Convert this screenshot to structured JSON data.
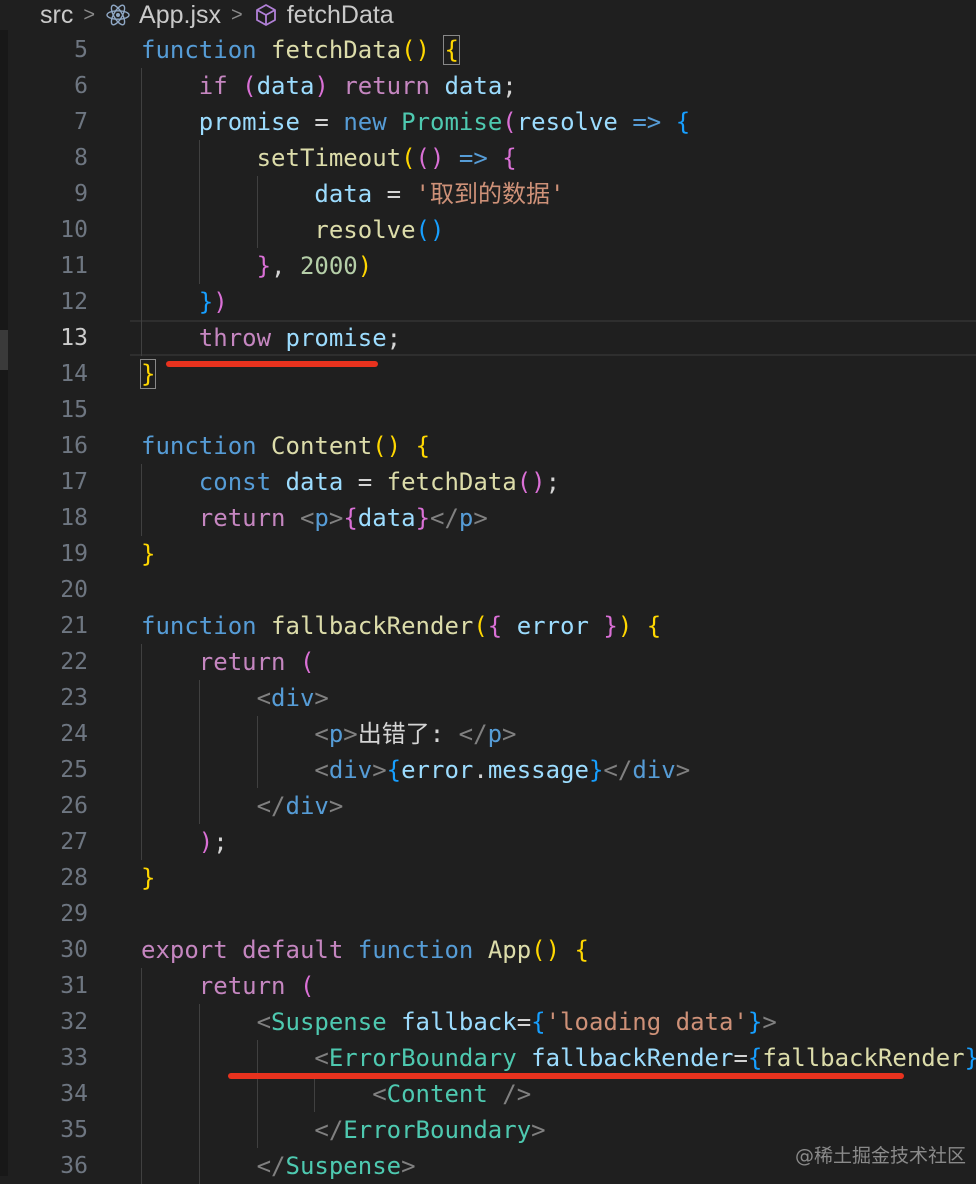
{
  "breadcrumb": {
    "folder": "src",
    "file": "App.jsx",
    "symbol": "fetchData",
    "file_icon": "react-icon",
    "symbol_icon": "cube-method-icon"
  },
  "lines": [
    {
      "n": "5",
      "indent": 0,
      "tokens": [
        [
          "kw-blue",
          "function"
        ],
        [
          "punc",
          " "
        ],
        [
          "fn",
          "fetchData"
        ],
        [
          "b1",
          "()"
        ],
        [
          "punc",
          " "
        ],
        [
          "b1",
          "{"
        ]
      ]
    },
    {
      "n": "6",
      "indent": 1,
      "tokens": [
        [
          "kw-pink",
          "if"
        ],
        [
          "punc",
          " "
        ],
        [
          "b2",
          "("
        ],
        [
          "var",
          "data"
        ],
        [
          "b2",
          ")"
        ],
        [
          "punc",
          " "
        ],
        [
          "kw-pink",
          "return"
        ],
        [
          "punc",
          " "
        ],
        [
          "var",
          "data"
        ],
        [
          "punc",
          ";"
        ]
      ]
    },
    {
      "n": "7",
      "indent": 1,
      "tokens": [
        [
          "var",
          "promise"
        ],
        [
          "punc",
          " = "
        ],
        [
          "kw-blue",
          "new"
        ],
        [
          "punc",
          " "
        ],
        [
          "cls",
          "Promise"
        ],
        [
          "b2",
          "("
        ],
        [
          "var",
          "resolve"
        ],
        [
          "punc",
          " "
        ],
        [
          "kw-blue",
          "=>"
        ],
        [
          "punc",
          " "
        ],
        [
          "b3",
          "{"
        ]
      ]
    },
    {
      "n": "8",
      "indent": 2,
      "tokens": [
        [
          "fn",
          "setTimeout"
        ],
        [
          "b1",
          "("
        ],
        [
          "b2",
          "()"
        ],
        [
          "punc",
          " "
        ],
        [
          "kw-blue",
          "=>"
        ],
        [
          "punc",
          " "
        ],
        [
          "b2",
          "{"
        ]
      ]
    },
    {
      "n": "9",
      "indent": 3,
      "tokens": [
        [
          "var",
          "data"
        ],
        [
          "punc",
          " = "
        ],
        [
          "str",
          "'取到的数据'"
        ]
      ]
    },
    {
      "n": "10",
      "indent": 3,
      "tokens": [
        [
          "fn",
          "resolve"
        ],
        [
          "b3",
          "()"
        ]
      ]
    },
    {
      "n": "11",
      "indent": 2,
      "tokens": [
        [
          "b2",
          "}"
        ],
        [
          "punc",
          ", "
        ],
        [
          "num",
          "2000"
        ],
        [
          "b1",
          ")"
        ]
      ]
    },
    {
      "n": "12",
      "indent": 1,
      "tokens": [
        [
          "b3",
          "}"
        ],
        [
          "b2",
          ")"
        ]
      ]
    },
    {
      "n": "13",
      "indent": 1,
      "current": true,
      "tokens": [
        [
          "kw-pink",
          "throw"
        ],
        [
          "punc",
          " "
        ],
        [
          "var",
          "promise"
        ],
        [
          "punc",
          ";"
        ]
      ]
    },
    {
      "n": "14",
      "indent": 0,
      "tokens": [
        [
          "b1",
          "}"
        ]
      ]
    },
    {
      "n": "15",
      "indent": 0,
      "tokens": []
    },
    {
      "n": "16",
      "indent": 0,
      "tokens": [
        [
          "kw-blue",
          "function"
        ],
        [
          "punc",
          " "
        ],
        [
          "fn",
          "Content"
        ],
        [
          "b1",
          "()"
        ],
        [
          "punc",
          " "
        ],
        [
          "b1",
          "{"
        ]
      ]
    },
    {
      "n": "17",
      "indent": 1,
      "tokens": [
        [
          "kw-blue",
          "const"
        ],
        [
          "punc",
          " "
        ],
        [
          "var",
          "data"
        ],
        [
          "punc",
          " = "
        ],
        [
          "fn",
          "fetchData"
        ],
        [
          "b2",
          "()"
        ],
        [
          "punc",
          ";"
        ]
      ]
    },
    {
      "n": "18",
      "indent": 1,
      "tokens": [
        [
          "kw-pink",
          "return"
        ],
        [
          "punc",
          " "
        ],
        [
          "tag",
          "<"
        ],
        [
          "kw-blue",
          "p"
        ],
        [
          "tag",
          ">"
        ],
        [
          "b2",
          "{"
        ],
        [
          "var",
          "data"
        ],
        [
          "b2",
          "}"
        ],
        [
          "tag",
          "</"
        ],
        [
          "kw-blue",
          "p"
        ],
        [
          "tag",
          ">"
        ]
      ]
    },
    {
      "n": "19",
      "indent": 0,
      "tokens": [
        [
          "b1",
          "}"
        ]
      ]
    },
    {
      "n": "20",
      "indent": 0,
      "tokens": []
    },
    {
      "n": "21",
      "indent": 0,
      "tokens": [
        [
          "kw-blue",
          "function"
        ],
        [
          "punc",
          " "
        ],
        [
          "fn",
          "fallbackRender"
        ],
        [
          "b1",
          "("
        ],
        [
          "b2",
          "{"
        ],
        [
          "punc",
          " "
        ],
        [
          "var",
          "error"
        ],
        [
          "punc",
          " "
        ],
        [
          "b2",
          "}"
        ],
        [
          "b1",
          ")"
        ],
        [
          "punc",
          " "
        ],
        [
          "b1",
          "{"
        ]
      ]
    },
    {
      "n": "22",
      "indent": 1,
      "tokens": [
        [
          "kw-pink",
          "return"
        ],
        [
          "punc",
          " "
        ],
        [
          "b2",
          "("
        ]
      ]
    },
    {
      "n": "23",
      "indent": 2,
      "tokens": [
        [
          "tag",
          "<"
        ],
        [
          "kw-blue",
          "div"
        ],
        [
          "tag",
          ">"
        ]
      ]
    },
    {
      "n": "24",
      "indent": 3,
      "tokens": [
        [
          "tag",
          "<"
        ],
        [
          "kw-blue",
          "p"
        ],
        [
          "tag",
          ">"
        ],
        [
          "punc",
          "出错了: "
        ],
        [
          "tag",
          "</"
        ],
        [
          "kw-blue",
          "p"
        ],
        [
          "tag",
          ">"
        ]
      ]
    },
    {
      "n": "25",
      "indent": 3,
      "tokens": [
        [
          "tag",
          "<"
        ],
        [
          "kw-blue",
          "div"
        ],
        [
          "tag",
          ">"
        ],
        [
          "b3",
          "{"
        ],
        [
          "var",
          "error"
        ],
        [
          "punc",
          "."
        ],
        [
          "var",
          "message"
        ],
        [
          "b3",
          "}"
        ],
        [
          "tag",
          "</"
        ],
        [
          "kw-blue",
          "div"
        ],
        [
          "tag",
          ">"
        ]
      ]
    },
    {
      "n": "26",
      "indent": 2,
      "tokens": [
        [
          "tag",
          "</"
        ],
        [
          "kw-blue",
          "div"
        ],
        [
          "tag",
          ">"
        ]
      ]
    },
    {
      "n": "27",
      "indent": 1,
      "tokens": [
        [
          "b2",
          ")"
        ],
        [
          "punc",
          ";"
        ]
      ]
    },
    {
      "n": "28",
      "indent": 0,
      "tokens": [
        [
          "b1",
          "}"
        ]
      ]
    },
    {
      "n": "29",
      "indent": 0,
      "tokens": []
    },
    {
      "n": "30",
      "indent": 0,
      "tokens": [
        [
          "kw-pink",
          "export"
        ],
        [
          "punc",
          " "
        ],
        [
          "kw-pink",
          "default"
        ],
        [
          "punc",
          " "
        ],
        [
          "kw-blue",
          "function"
        ],
        [
          "punc",
          " "
        ],
        [
          "fn",
          "App"
        ],
        [
          "b1",
          "()"
        ],
        [
          "punc",
          " "
        ],
        [
          "b1",
          "{"
        ]
      ]
    },
    {
      "n": "31",
      "indent": 1,
      "tokens": [
        [
          "kw-pink",
          "return"
        ],
        [
          "punc",
          " "
        ],
        [
          "b2",
          "("
        ]
      ]
    },
    {
      "n": "32",
      "indent": 2,
      "tokens": [
        [
          "tag",
          "<"
        ],
        [
          "cls",
          "Suspense"
        ],
        [
          "punc",
          " "
        ],
        [
          "var",
          "fallback"
        ],
        [
          "punc",
          "="
        ],
        [
          "b3",
          "{"
        ],
        [
          "str",
          "'loading data'"
        ],
        [
          "b3",
          "}"
        ],
        [
          "tag",
          ">"
        ]
      ]
    },
    {
      "n": "33",
      "indent": 3,
      "tokens": [
        [
          "tag",
          "<"
        ],
        [
          "cls",
          "ErrorBoundary"
        ],
        [
          "punc",
          " "
        ],
        [
          "var",
          "fallbackRender"
        ],
        [
          "punc",
          "="
        ],
        [
          "b3",
          "{"
        ],
        [
          "fn",
          "fallbackRender"
        ],
        [
          "b3",
          "}"
        ],
        [
          "tag",
          ">"
        ]
      ]
    },
    {
      "n": "34",
      "indent": 4,
      "tokens": [
        [
          "tag",
          "<"
        ],
        [
          "cls",
          "Content"
        ],
        [
          "punc",
          " "
        ],
        [
          "tag",
          "/>"
        ]
      ]
    },
    {
      "n": "35",
      "indent": 3,
      "tokens": [
        [
          "tag",
          "</"
        ],
        [
          "cls",
          "ErrorBoundary"
        ],
        [
          "tag",
          ">"
        ]
      ]
    },
    {
      "n": "36",
      "indent": 2,
      "tokens": [
        [
          "tag",
          "</"
        ],
        [
          "cls",
          "Suspense"
        ],
        [
          "tag",
          ">"
        ]
      ]
    }
  ],
  "watermark": "@稀土掘金技术社区",
  "underline_color": "#e8321e"
}
